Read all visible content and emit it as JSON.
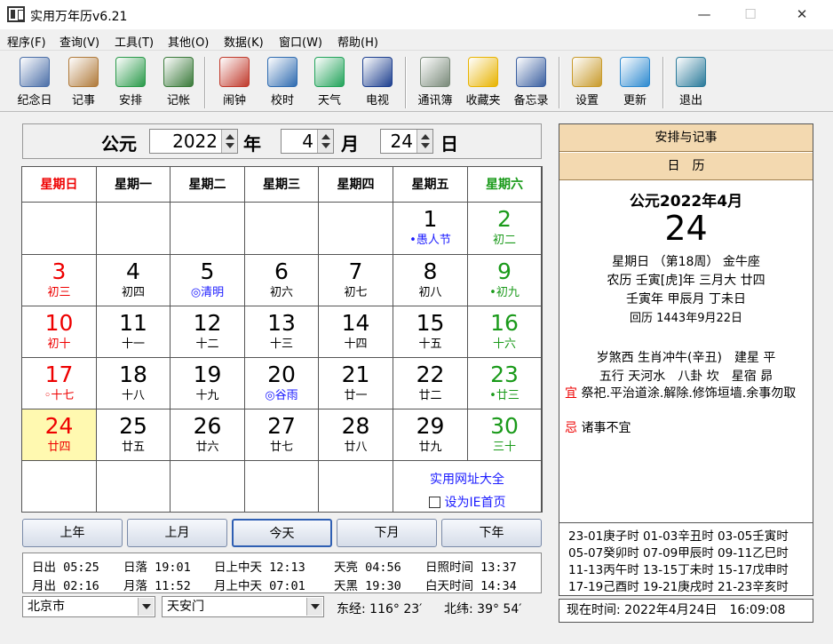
{
  "window": {
    "title": "实用万年历v6.21",
    "min": "—",
    "max": "☐",
    "close": "✕"
  },
  "menu": [
    "程序(F)",
    "查询(V)",
    "工具(T)",
    "其他(O)",
    "数据(K)",
    "窗口(W)",
    "帮助(H)"
  ],
  "toolbar": [
    {
      "label": "纪念日",
      "icon": "film-reel-icon",
      "color": "#4b6fa8"
    },
    {
      "label": "记事",
      "icon": "hand-write-icon",
      "color": "#b07a3a"
    },
    {
      "label": "安排",
      "icon": "calendar-clock-icon",
      "color": "#2a9a4a"
    },
    {
      "label": "记帐",
      "icon": "ledger-icon",
      "color": "#3a7a3a"
    },
    {
      "label": "闹钟",
      "icon": "alarm-clock-icon",
      "color": "#c0392b"
    },
    {
      "label": "校时",
      "icon": "globe-clock-icon",
      "color": "#2e6bb0"
    },
    {
      "label": "天气",
      "icon": "weather-icon",
      "color": "#22a35a"
    },
    {
      "label": "电视",
      "icon": "tv-icon",
      "color": "#1d3f8f"
    },
    {
      "label": "通讯簿",
      "icon": "phone-book-icon",
      "color": "#7a8a7a"
    },
    {
      "label": "收藏夹",
      "icon": "star-icon",
      "color": "#e8b300"
    },
    {
      "label": "备忘录",
      "icon": "memo-icon",
      "color": "#3a5fa0"
    },
    {
      "label": "设置",
      "icon": "tools-icon",
      "color": "#c89a2a"
    },
    {
      "label": "更新",
      "icon": "update-globe-icon",
      "color": "#2d8ad0"
    },
    {
      "label": "退出",
      "icon": "exit-door-icon",
      "color": "#2a7a9a"
    }
  ],
  "datebar": {
    "era": "公元",
    "year": "2022",
    "year_unit": "年",
    "month": "4",
    "month_unit": "月",
    "day": "24",
    "day_unit": "日"
  },
  "weekdays": [
    "星期日",
    "星期一",
    "星期二",
    "星期三",
    "星期四",
    "星期五",
    "星期六"
  ],
  "weeks": [
    [
      {},
      {},
      {},
      {},
      {},
      {
        "d": "1",
        "s": "•愚人节",
        "sc": "blue"
      },
      {
        "d": "2",
        "s": "初二"
      }
    ],
    [
      {
        "d": "3",
        "s": "初三"
      },
      {
        "d": "4",
        "s": "初四"
      },
      {
        "d": "5",
        "s": "◎清明",
        "sc": "blue"
      },
      {
        "d": "6",
        "s": "初六"
      },
      {
        "d": "7",
        "s": "初七"
      },
      {
        "d": "8",
        "s": "初八"
      },
      {
        "d": "9",
        "s": "•初九"
      }
    ],
    [
      {
        "d": "10",
        "s": "初十"
      },
      {
        "d": "11",
        "s": "十一"
      },
      {
        "d": "12",
        "s": "十二"
      },
      {
        "d": "13",
        "s": "十三"
      },
      {
        "d": "14",
        "s": "十四"
      },
      {
        "d": "15",
        "s": "十五"
      },
      {
        "d": "16",
        "s": "十六"
      }
    ],
    [
      {
        "d": "17",
        "s": "◦十七"
      },
      {
        "d": "18",
        "s": "十八"
      },
      {
        "d": "19",
        "s": "十九"
      },
      {
        "d": "20",
        "s": "◎谷雨",
        "sc": "blue"
      },
      {
        "d": "21",
        "s": "廿一"
      },
      {
        "d": "22",
        "s": "廿二"
      },
      {
        "d": "23",
        "s": "•廿三"
      }
    ],
    [
      {
        "d": "24",
        "s": "廿四",
        "today": true
      },
      {
        "d": "25",
        "s": "廿五"
      },
      {
        "d": "26",
        "s": "廿六"
      },
      {
        "d": "27",
        "s": "廿七"
      },
      {
        "d": "28",
        "s": "廿八"
      },
      {
        "d": "29",
        "s": "廿九"
      },
      {
        "d": "30",
        "s": "三十"
      }
    ]
  ],
  "links": {
    "site": "实用网址大全",
    "homepage": "设为IE首页"
  },
  "nav": [
    "上年",
    "上月",
    "今天",
    "下月",
    "下年"
  ],
  "sun": {
    "row1": [
      "日出 05:25",
      "日落 19:01",
      "日上中天 12:13",
      "天亮 04:56",
      "日照时间 13:37"
    ],
    "row2": [
      "月出 02:16",
      "月落 11:52",
      "月上中天 07:01",
      "天黑 19:30",
      "白天时间 14:34"
    ]
  },
  "location": {
    "city": "北京市",
    "place": "天安门",
    "lng": "东经: 116° 23′",
    "lat": "北纬: 39° 54′"
  },
  "right": {
    "tab1": "安排与记事",
    "tab2": "日　历",
    "head": "公元2022年4月",
    "big_day": "24",
    "line1": "星期日 （第18周） 金牛座",
    "line2": "农历 壬寅[虎]年 三月大 廿四",
    "line3": "壬寅年 甲辰月 丁未日",
    "line4": "回历 1443年9月22日",
    "line5": "岁煞西 生肖冲牛(辛丑)　建星 平",
    "line6": "五行 天河水　八卦 坎　星宿 昴",
    "yi_tag": "宜",
    "yi": "祭祀.平治道涂.解除.修饰垣墙.余事勿取",
    "ji_tag": "忌",
    "ji": "诸事不宜",
    "hours": [
      "23-01庚子时 01-03辛丑时 03-05壬寅时",
      "05-07癸卯时 07-09甲辰时 09-11乙巳时",
      "11-13丙午时 13-15丁未时 15-17戊申时",
      "17-19己酉时 19-21庚戌时 21-23辛亥时"
    ],
    "clock": "现在时间: 2022年4月24日　16:09:08"
  },
  "colors": {
    "sunday": "#e00000",
    "saturday": "#1a9a1a",
    "link": "#1a1aff",
    "today_bg": "#fff9b0",
    "panel_head": "#f3d9b0"
  }
}
